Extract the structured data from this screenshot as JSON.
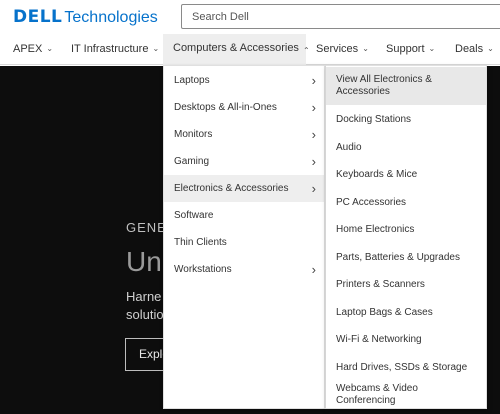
{
  "header": {
    "logo_brand": "DELL",
    "logo_suffix": "Technologies",
    "search_placeholder": "Search Dell"
  },
  "nav": {
    "items": [
      {
        "label": "APEX"
      },
      {
        "label": "IT Infrastructure"
      },
      {
        "label": "Computers & Accessories"
      },
      {
        "label": "Services"
      },
      {
        "label": "Support"
      },
      {
        "label": "Deals"
      }
    ]
  },
  "hero": {
    "eyebrow": "GENE",
    "title": "Unl",
    "body_line1": "Harne",
    "body_line2": "solutio",
    "button": "Explo"
  },
  "menu": {
    "level1": [
      {
        "label": "Laptops",
        "has_submenu": true
      },
      {
        "label": "Desktops & All-in-Ones",
        "has_submenu": true
      },
      {
        "label": "Monitors",
        "has_submenu": true
      },
      {
        "label": "Gaming",
        "has_submenu": true
      },
      {
        "label": "Electronics & Accessories",
        "has_submenu": true,
        "active": true
      },
      {
        "label": "Software",
        "has_submenu": false
      },
      {
        "label": "Thin Clients",
        "has_submenu": false
      },
      {
        "label": "Workstations",
        "has_submenu": true
      }
    ],
    "level2": [
      {
        "label": "View All Electronics & Accessories"
      },
      {
        "label": "Docking Stations"
      },
      {
        "label": "Audio"
      },
      {
        "label": "Keyboards & Mice"
      },
      {
        "label": "PC Accessories"
      },
      {
        "label": "Home Electronics"
      },
      {
        "label": "Parts, Batteries & Upgrades"
      },
      {
        "label": "Printers & Scanners"
      },
      {
        "label": "Laptop Bags & Cases"
      },
      {
        "label": "Wi-Fi & Networking"
      },
      {
        "label": "Hard Drives, SSDs & Storage"
      },
      {
        "label": "Webcams & Video Conferencing"
      }
    ]
  },
  "icons": {
    "chevron_down": "chevron-down-icon",
    "chevron_up": "chevron-up-icon",
    "chevron_right": "chevron-right-icon"
  },
  "colors": {
    "brand": "#0672cb",
    "hero_bg": "#0d0d0d",
    "active_bg": "#eeeeee"
  }
}
